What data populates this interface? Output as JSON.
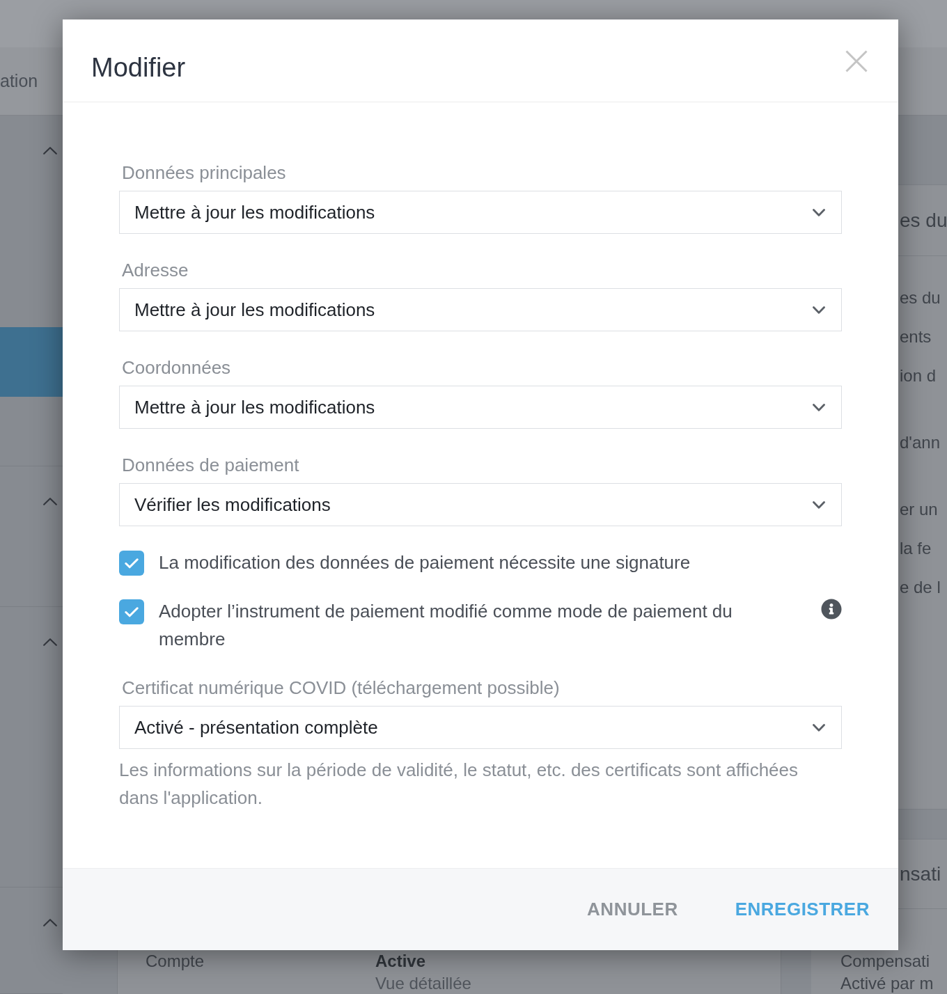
{
  "background": {
    "tab_text": "ation",
    "nav_sections": [
      {
        "expanded": true,
        "rows": [
          {
            "selected": true
          }
        ]
      },
      {
        "expanded": true
      },
      {
        "expanded": true
      },
      {
        "expanded": true
      }
    ],
    "right_panels": [
      {
        "title": "es du",
        "groups": [
          {
            "lines": [
              "es du",
              "ents",
              "ion d"
            ]
          },
          {
            "lines": [
              "d'ann"
            ]
          },
          {
            "lines": [
              "er un",
              "la fe",
              "e de l"
            ]
          }
        ]
      },
      {
        "title": "nsati",
        "groups": [
          {
            "lines": [
              "Compensati",
              "Activé par m"
            ]
          }
        ]
      }
    ],
    "bottom_card": {
      "label": "Compte",
      "value": "Active",
      "detail": "Vue détaillée"
    }
  },
  "dialog": {
    "title": "Modifier",
    "fields": [
      {
        "label": "Données principales",
        "value": "Mettre à jour les modifications"
      },
      {
        "label": "Adresse",
        "value": "Mettre à jour les modifications"
      },
      {
        "label": "Coordonnées",
        "value": "Mettre à jour les modifications"
      },
      {
        "label": "Données de paiement",
        "value": "Vérifier les modifications"
      }
    ],
    "checkboxes": [
      {
        "label": "La modification des données de paiement nécessite une signature",
        "checked": true,
        "info": false
      },
      {
        "label": "Adopter l’instrument de paiement modifié comme mode de paiement du membre",
        "checked": true,
        "info": true
      }
    ],
    "covid_field": {
      "label": "Certificat numérique COVID (téléchargement possible)",
      "value": "Activé - présentation complète",
      "help": "Les informations sur la période de validité, le statut, etc. des certificats sont affichées dans l'application."
    },
    "buttons": [
      {
        "label": "ANNULER",
        "kind": "secondary"
      },
      {
        "label": "ENREGISTRER",
        "kind": "primary"
      }
    ]
  }
}
